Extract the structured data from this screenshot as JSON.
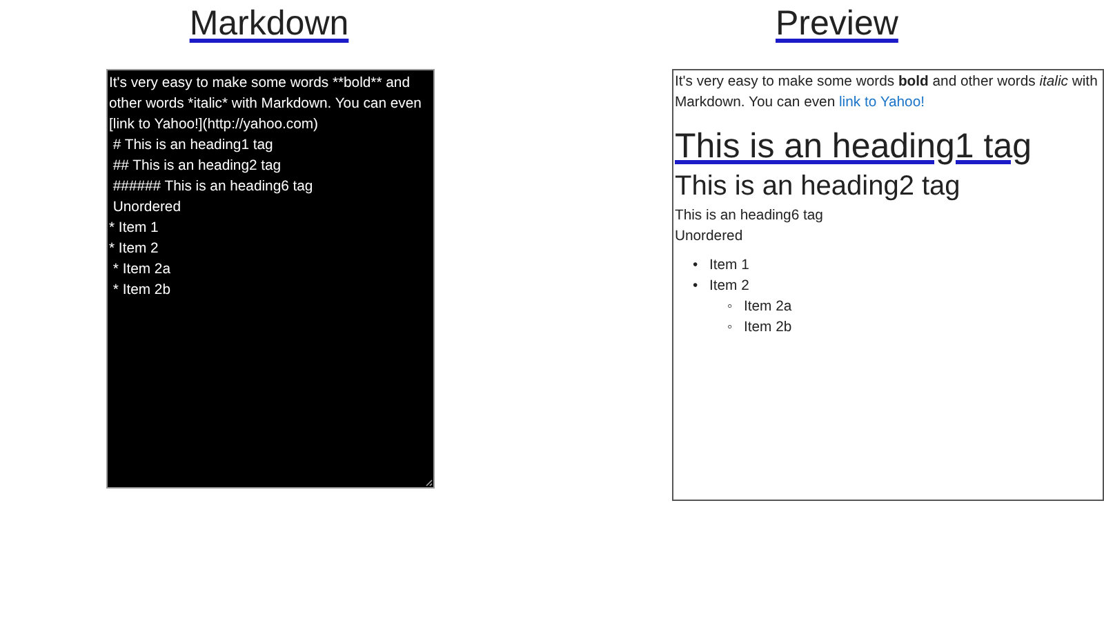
{
  "markdown_pane": {
    "title": "Markdown",
    "editor": {
      "lines": [
        "It's very easy to make some words **bold** and other words *italic* with Markdown. You can even [link to Yahoo!](http://yahoo.com)",
        " # This is an heading1 tag",
        " ## This is an heading2 tag",
        " ###### This is an heading6 tag",
        " Unordered",
        "* Item 1",
        "* Item 2",
        " * Item 2a",
        " * Item 2b"
      ]
    }
  },
  "preview_pane": {
    "title": "Preview",
    "paragraph": {
      "text": "It's very easy to make some words **bold** and other words *italic* with Markdown. You can even ",
      "link": "link to Yahoo!"
    },
    "heading1": "This is an heading1 tag",
    "heading2": "This is an heading2 tag",
    "heading6": "This is an heading6 tag",
    "list_title": "Unordered",
    "list": [
      {
        "marker": "•",
        "text": "Item 1"
      },
      {
        "marker": "•",
        "text": "Item 2",
        "children": [
          {
            "marker": "◦",
            "text": "Item 2a"
          },
          {
            "marker": "◦",
            "text": "Item 2b"
          }
        ]
      }
    ]
  }
}
